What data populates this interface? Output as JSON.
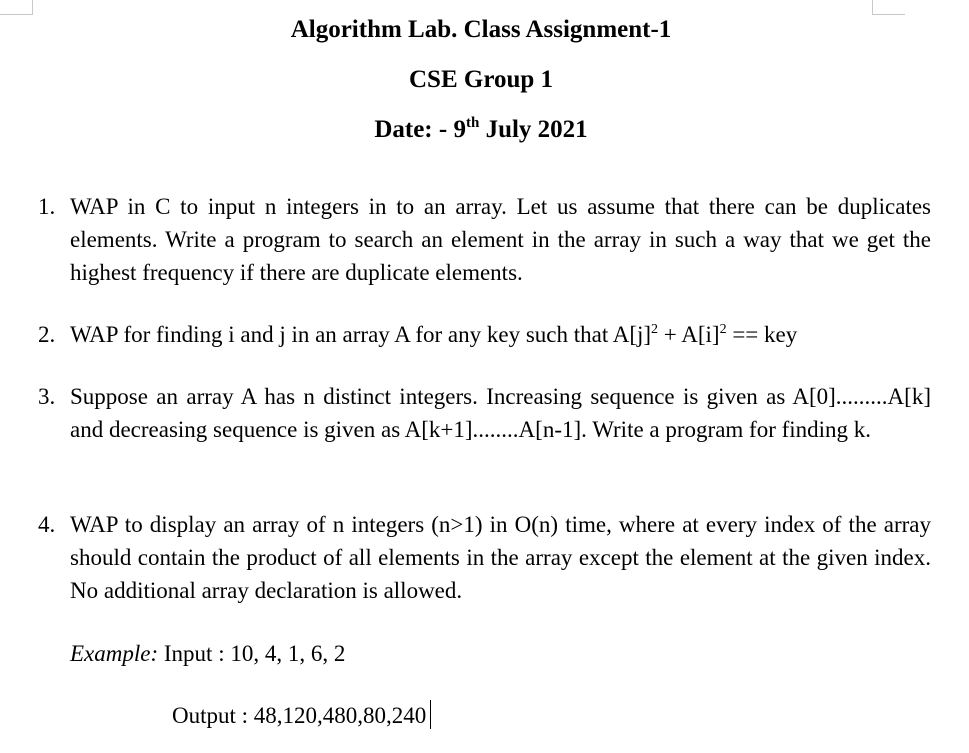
{
  "title": "Algorithm Lab. Class Assignment-1",
  "group": "CSE Group 1",
  "date": {
    "prefix": "Date: - 9",
    "superscript": "th",
    "suffix": " July 2021"
  },
  "questions": [
    {
      "number": "1.",
      "text": "WAP in C to input n integers in to an array. Let us assume that there can be duplicates elements. Write a program to search an element in the array in such a way that we get the highest frequency if there are duplicate elements."
    },
    {
      "number": "2.",
      "text_a": "WAP for finding i and j in an array A for any key such that A[j]",
      "sup_a": "2",
      "text_b": " + A[i]",
      "sup_b": "2",
      "text_c": " == key"
    },
    {
      "number": "3.",
      "text": "Suppose an array A has n distinct integers. Increasing sequence is given as A[0].........A[k] and decreasing sequence is given as A[k+1]........A[n-1]. Write a program for finding k."
    },
    {
      "number": "4.",
      "text": "WAP to display an array of n integers (n>1) in O(n) time, where at every index of the array should contain the product of all elements in the array except the element at the given index. No additional array declaration is allowed."
    }
  ],
  "example": {
    "label": "Example:",
    "input": " Input : 10, 4, 1, 6, 2",
    "output": "Output : 48,120,480,80,240"
  }
}
